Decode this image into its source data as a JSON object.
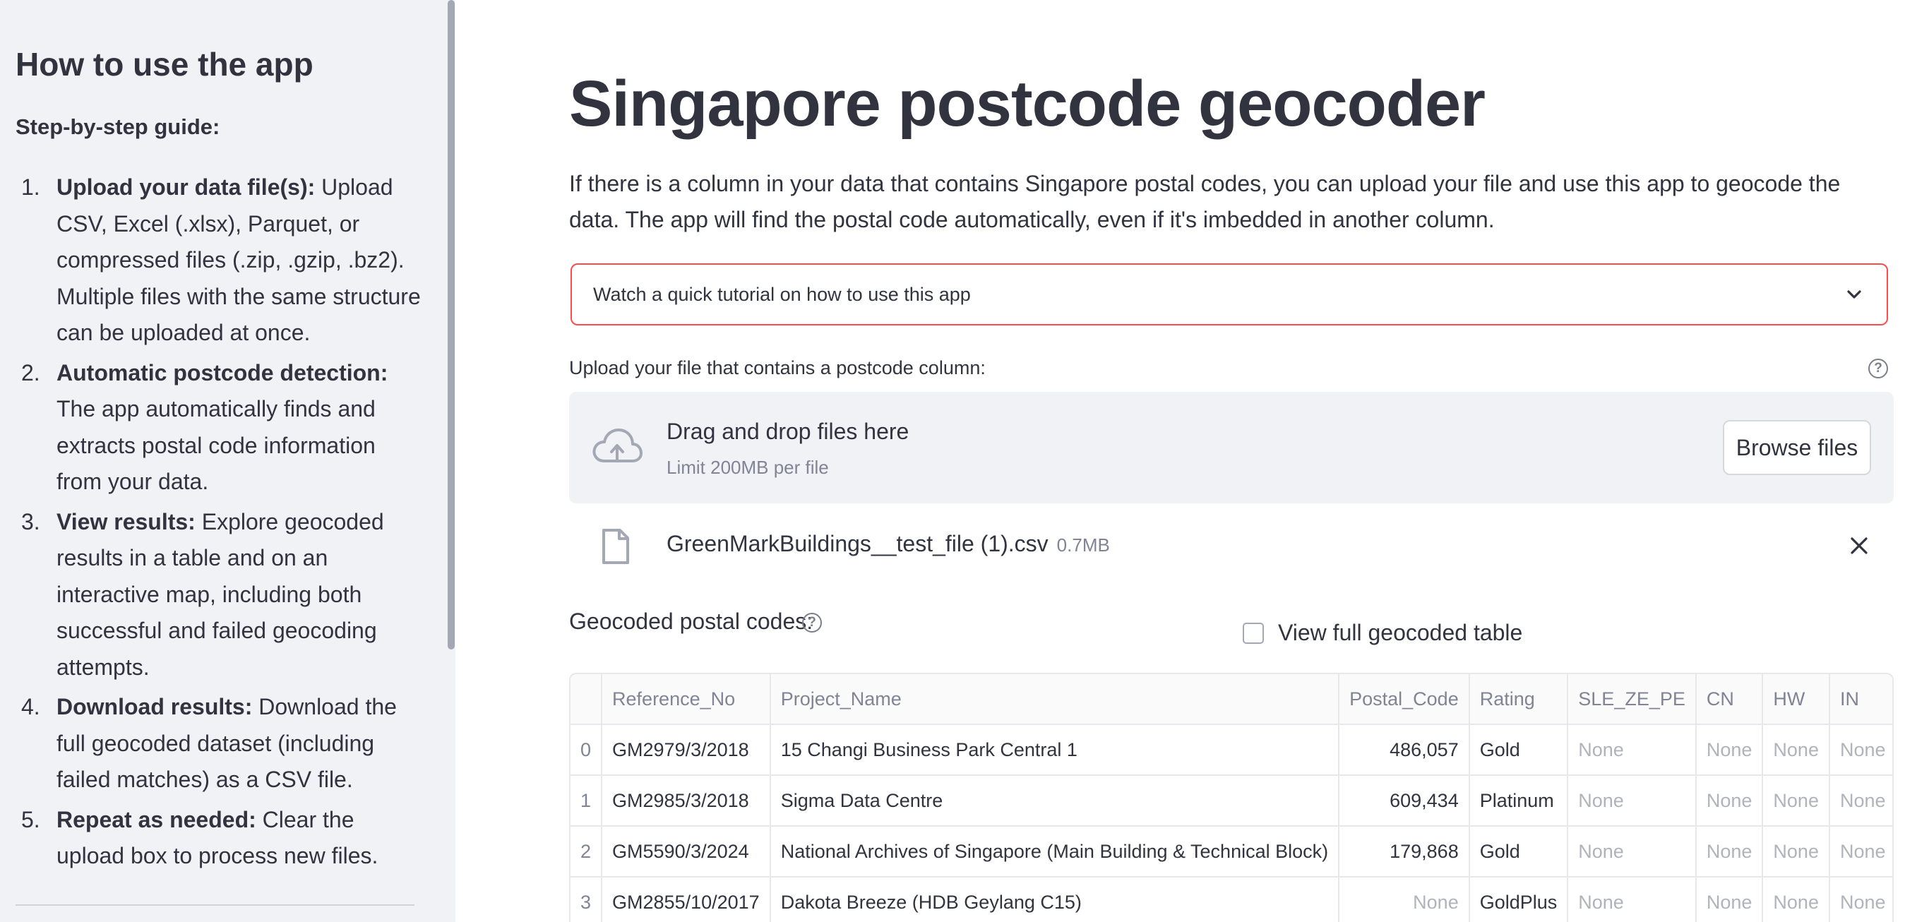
{
  "sidebar": {
    "title": "How to use the app",
    "subtitle": "Step-by-step guide:",
    "steps": [
      {
        "num": "1.",
        "bold": "Upload your data file(s):",
        "text": " Upload CSV, Excel (.xlsx), Parquet, or compressed files (.zip, .gzip, .bz2). Multiple files with the same structure can be uploaded at once."
      },
      {
        "num": "2.",
        "bold": "Automatic postcode detection:",
        "text": " The app automatically finds and extracts postal code information from your data."
      },
      {
        "num": "3.",
        "bold": "View results:",
        "text": " Explore geocoded results in a table and on an interactive map, including both successful and failed geocoding attempts."
      },
      {
        "num": "4.",
        "bold": "Download results:",
        "text": " Download the full geocoded dataset (including failed matches) as a CSV file."
      },
      {
        "num": "5.",
        "bold": "Repeat as needed:",
        "text": " Clear the upload box to process new files."
      }
    ]
  },
  "main": {
    "title": "Singapore postcode geocoder",
    "intro": "If there is a column in your data that contains Singapore postal codes, you can upload your file and use this app to geocode the data. The app will find the postal code automatically, even if it's imbedded in another column.",
    "expander_label": "Watch a quick tutorial on how to use this app",
    "upload_label": "Upload your file that contains a postcode column:",
    "help_glyph": "?",
    "dropzone": {
      "title": "Drag and drop files here",
      "limit": "Limit 200MB per file",
      "browse_label": "Browse files"
    },
    "file": {
      "name": "GreenMarkBuildings__test_file (1).csv",
      "size": "0.7MB"
    },
    "geocoded_label": "Geocoded postal codes:",
    "view_full_label": "View full geocoded table"
  },
  "table": {
    "columns": [
      "",
      "Reference_No",
      "Project_Name",
      "Postal_Code",
      "Rating",
      "SLE_ZE_PE",
      "CN",
      "HW",
      "IN"
    ],
    "rows": [
      [
        "0",
        "GM2979/3/2018",
        "15 Changi Business Park Central 1",
        "486,057",
        "Gold",
        "None",
        "None",
        "None",
        "None"
      ],
      [
        "1",
        "GM2985/3/2018",
        "Sigma Data Centre",
        "609,434",
        "Platinum",
        "None",
        "None",
        "None",
        "None"
      ],
      [
        "2",
        "GM5590/3/2024",
        "National Archives of Singapore (Main Building & Technical Block)",
        "179,868",
        "Gold",
        "None",
        "None",
        "None",
        "None"
      ],
      [
        "3",
        "GM2855/10/2017",
        "Dakota Breeze (HDB Geylang C15)",
        "None",
        "GoldPlus",
        "None",
        "None",
        "None",
        "None"
      ]
    ]
  },
  "colors": {
    "sidebar_bg": "#f0f2f6",
    "accent_border": "#ff4b4b",
    "text": "#31333f",
    "muted": "#808495"
  },
  "icons": [
    "cloud-upload-icon",
    "file-icon",
    "close-icon",
    "help-icon",
    "chevron-down-icon"
  ]
}
